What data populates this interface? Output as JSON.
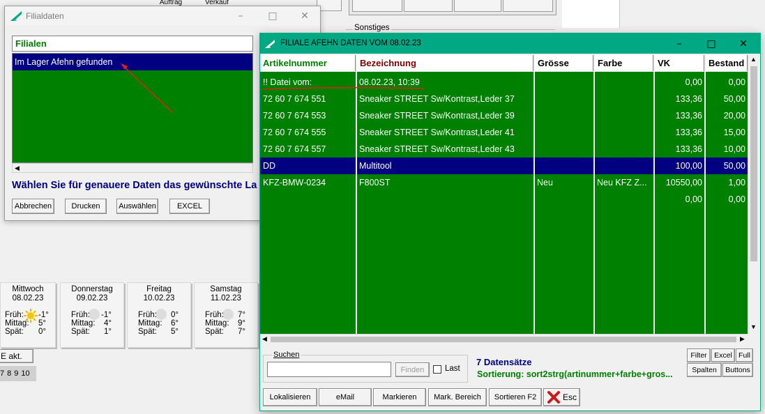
{
  "background": {
    "top_labels": [
      "Auftrag",
      "Verkauf"
    ],
    "sonstiges_label": "Sonstiges",
    "weather": [
      {
        "day": "Mittwoch",
        "date": "08.02.23",
        "frueh": "Früh:",
        "frueh_v": "-1°",
        "mittag": "Mittag:",
        "mittag_v": "5°",
        "spaet": "Spät:",
        "spaet_v": "0°"
      },
      {
        "day": "Donnerstag",
        "date": "09.02.23",
        "frueh": "Früh:",
        "frueh_v": "-1°",
        "mittag": "Mittag:",
        "mittag_v": "4°",
        "spaet": "Spät:",
        "spaet_v": "1°"
      },
      {
        "day": "Freitag",
        "date": "10.02.23",
        "frueh": "Früh:",
        "frueh_v": "0°",
        "mittag": "Mittag:",
        "mittag_v": "6°",
        "spaet": "Spät:",
        "spaet_v": "5°"
      },
      {
        "day": "Samstag",
        "date": "11.02.23",
        "frueh": "Früh:",
        "frueh_v": "7°",
        "mittag": "Mittag:",
        "mittag_v": "9°",
        "spaet": "Spät:",
        "spaet_v": "7°"
      }
    ],
    "akt_button": "E akt.",
    "numbers": [
      "7",
      "8",
      "9",
      "10"
    ]
  },
  "filialdaten": {
    "title": "Filialdaten",
    "list_header": "Filialen",
    "list_items": [
      "Im Lager Afehn gefunden"
    ],
    "hint": "Wählen Sie für genauere Daten das gewünschte La",
    "buttons": [
      "Abbrechen",
      "Drucken",
      "Auswählen",
      "EXCEL"
    ]
  },
  "filiale": {
    "title": "FILIALE AFEHN DATEN VOM 08.02.23",
    "columns": [
      "Artikelnummer",
      "Bezeichnung",
      "Grösse",
      "Farbe",
      "VK",
      "Bestand"
    ],
    "rows": [
      {
        "artikel": "!! Datei vom:",
        "bez": "08.02.23, 10:39",
        "groesse": "",
        "farbe": "",
        "vk": "0,00",
        "bestand": "0,00"
      },
      {
        "artikel": "72 60 7 674 551",
        "bez": "Sneaker STREET Sw/Kontrast,Leder 37",
        "groesse": "",
        "farbe": "",
        "vk": "133,36",
        "bestand": "50,00"
      },
      {
        "artikel": "72 60 7 674 553",
        "bez": "Sneaker STREET Sw/Kontrast,Leder 39",
        "groesse": "",
        "farbe": "",
        "vk": "133,36",
        "bestand": "20,00"
      },
      {
        "artikel": "72 60 7 674 555",
        "bez": "Sneaker STREET Sw/Kontrast,Leder 41",
        "groesse": "",
        "farbe": "",
        "vk": "133,36",
        "bestand": "15,00"
      },
      {
        "artikel": "72 60 7 674 557",
        "bez": "Sneaker STREET Sw/Kontrast,Leder 43",
        "groesse": "",
        "farbe": "",
        "vk": "133,36",
        "bestand": "10,00"
      },
      {
        "artikel": "DD",
        "bez": "Multitool",
        "groesse": "",
        "farbe": "",
        "vk": "100,00",
        "bestand": "50,00"
      },
      {
        "artikel": "KFZ-BMW-0234",
        "bez": "F800ST",
        "groesse": "Neu",
        "farbe": "Neu KFZ Z...",
        "vk": "10550,00",
        "bestand": "1,00"
      },
      {
        "artikel": "",
        "bez": "",
        "groesse": "",
        "farbe": "",
        "vk": "0,00",
        "bestand": "0,00"
      }
    ],
    "selected_row": 5,
    "search": {
      "label": "Suchen",
      "value": "",
      "find_button": "Finden",
      "last_label": "Last"
    },
    "status_count": "7 Datensätze",
    "status_sort": "Sortierung: sort2strg(artinummer+farbe+gros...",
    "right_buttons": [
      "Filter",
      "Excel",
      "Full",
      "Spalten",
      "Buttons"
    ],
    "bottom_buttons": [
      "Lokalisieren",
      "eMail",
      "Markieren",
      "Mark. Bereich",
      "Sortieren F2",
      "Esc"
    ]
  },
  "colors": {
    "table_bg": "#008000",
    "selection": "#000080",
    "accent": "#00a884",
    "annotation": "#e02020"
  }
}
